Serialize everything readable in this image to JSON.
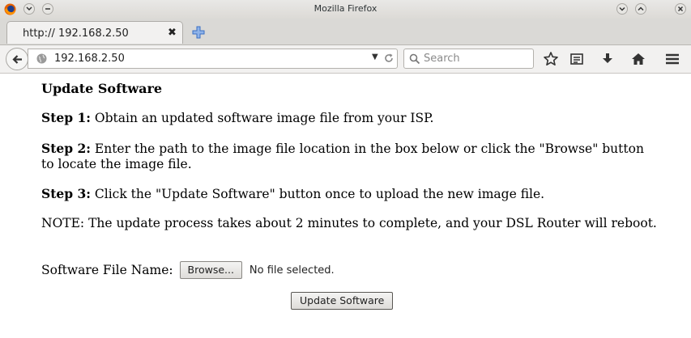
{
  "window": {
    "title": "Mozilla Firefox",
    "controls": [
      "chevron-up-icon",
      "minimize-icon",
      "close-icon"
    ],
    "menu_icons": [
      "firefox-logo-icon",
      "chevron-down-icon",
      "chevron-up-icon",
      "close-icon"
    ]
  },
  "tab": {
    "label": "http:// 192.168.2.50",
    "close_glyph": "✖"
  },
  "navbar": {
    "url": "192.168.2.50",
    "search_placeholder": "Search",
    "toolbar_icons": [
      "star-icon",
      "reading-list-icon",
      "download-icon",
      "home-icon",
      "menu-icon"
    ]
  },
  "page": {
    "heading": "Update Software",
    "step1_label": "Step 1:",
    "step1_text": " Obtain an updated software image file from your ISP.",
    "step2_label": "Step 2:",
    "step2_text": " Enter the path to the image file location in the box below or click the \"Browse\" button to locate the image file.",
    "step3_label": "Step 3:",
    "step3_text": " Click the \"Update Software\" button once to upload the new image file.",
    "note_text": "NOTE: The update process takes about 2 minutes to complete, and your DSL Router will reboot.",
    "file_label": "Software File Name:",
    "browse_label": "Browse...",
    "file_status": "No file selected.",
    "update_button": "Update Software"
  },
  "colors": {
    "chrome_bg": "#dad9d6",
    "toolbar_bg": "#f2f1f0",
    "newtab_plus": "#3a6fc4"
  }
}
